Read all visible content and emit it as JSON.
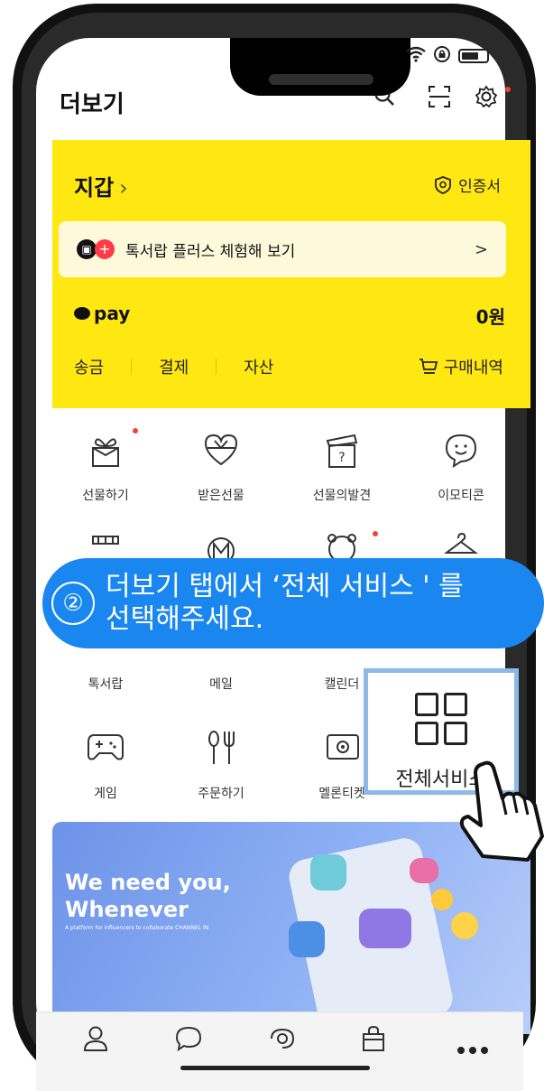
{
  "status_bar": {
    "wifi_icon": "wifi-icon",
    "lock_icon": "lock-icon",
    "battery_icon": "battery-icon"
  },
  "header": {
    "title": "더보기",
    "search_icon": "search-icon",
    "scan_icon": "scan-icon",
    "settings_icon": "gear-icon"
  },
  "wallet": {
    "title": "지갑",
    "chevron": "›",
    "cert_label": "인증서",
    "plus_banner": "톡서랍 플러스 체험해 보기",
    "plus_chevron": ">",
    "pay_label": "pay",
    "pay_amount": "0원",
    "links": [
      "송금",
      "결제",
      "자산"
    ],
    "purchase_label": "구매내역",
    "background": "#ffe812"
  },
  "grid": {
    "row1": [
      "선물하기",
      "받은선물",
      "선물의발견",
      "이모티콘"
    ],
    "row2": [
      "톡서랍",
      "메일",
      "캘린더",
      ""
    ],
    "row3": [
      "게임",
      "주문하기",
      "멜론티켓",
      ""
    ]
  },
  "tooltip": {
    "number": "②",
    "line1": "더보기 탭에서 ‘전체 서비스 ' 를",
    "line2": "선택해주세요.",
    "color": "#1a86f0"
  },
  "highlight": {
    "label": "전체서비스",
    "border_color": "#8bb9e8"
  },
  "banner": {
    "title_line1": "We need you,",
    "title_line2": "Whenever",
    "subtitle": "A platform for influencers to collaborate CHANNEL IN"
  },
  "bottom_nav": {
    "items": [
      "person-icon",
      "chat-icon",
      "view-icon",
      "shopping-icon",
      "more-icon"
    ]
  }
}
